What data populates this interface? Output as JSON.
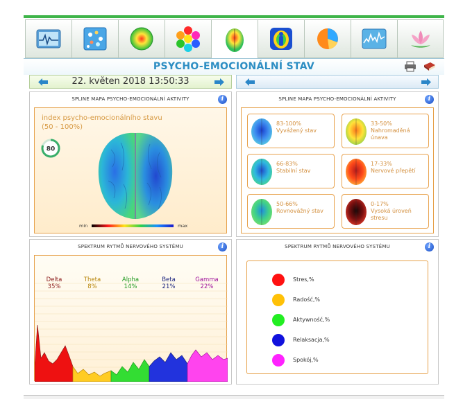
{
  "page": {
    "title": "PSYCHO-EMOCIONÁLNÍ STAV",
    "date": "22. květen 2018 13:50:33"
  },
  "tabs": [
    {
      "name": "cardio-icon",
      "active": false
    },
    {
      "name": "cells-icon",
      "active": false
    },
    {
      "name": "energy-ball-icon",
      "active": false
    },
    {
      "name": "hexagons-icon",
      "active": false
    },
    {
      "name": "brain-icon",
      "active": true
    },
    {
      "name": "aura-icon",
      "active": false
    },
    {
      "name": "pie-icon",
      "active": false
    },
    {
      "name": "waveform-icon",
      "active": false
    },
    {
      "name": "lotus-icon",
      "active": false
    }
  ],
  "toolbar": {
    "print_icon": "printer-icon",
    "book_icon": "book-icon"
  },
  "map_panel": {
    "title": "SPLINE MAPA PSYCHO-EMOCIONÁLNÍ AKTIVITY",
    "index_label": "index psycho-emocionálního stavu",
    "index_range": "(50 - 100%)",
    "index_value": "80",
    "index_fraction": 0.8,
    "scale_min": "min",
    "scale_max": "max"
  },
  "legend_panel": {
    "title": "SPLINE MAPA PSYCHO-EMOCIONÁLNÍ AKTIVITY",
    "items": [
      {
        "range": "83-100%",
        "line1": "Vyvážený stav",
        "line2": "",
        "palette": "blue"
      },
      {
        "range": "33-50%",
        "line1": "Nahromaděná",
        "line2": "únava",
        "palette": "yellow"
      },
      {
        "range": "66-83%",
        "line1": "Stabilní stav",
        "line2": "",
        "palette": "bluegreen"
      },
      {
        "range": "17-33%",
        "line1": "Nervové přepětí",
        "line2": "",
        "palette": "red"
      },
      {
        "range": "50-66%",
        "line1": "Rovnovážný stav",
        "line2": "",
        "palette": "green"
      },
      {
        "range": "0-17%",
        "line1": "Vysoká úroveň",
        "line2": "stresu",
        "palette": "dark"
      }
    ]
  },
  "spectrum_panel": {
    "title": "SPEKTRUM RYTMŮ NERVOVÉHO SYSTÉMU",
    "bands": [
      {
        "name": "Delta",
        "value": "35%",
        "color": "#8b1a1a",
        "fill": "#ee1111"
      },
      {
        "name": "Theta",
        "value": "8%",
        "color": "#b8860b",
        "fill": "#ffcc22"
      },
      {
        "name": "Alpha",
        "value": "14%",
        "color": "#1f9a1f",
        "fill": "#33dd33"
      },
      {
        "name": "Beta",
        "value": "21%",
        "color": "#1a237e",
        "fill": "#2233dd"
      },
      {
        "name": "Gamma",
        "value": "22%",
        "color": "#a0149b",
        "fill": "#ff44ee"
      }
    ]
  },
  "states_panel": {
    "title": "SPEKTRUM RYTMŮ NERVOVÉHO SYSTÉMU",
    "items": [
      {
        "label": "Stres,%",
        "color": "#ff1111"
      },
      {
        "label": "Radość,%",
        "color": "#ffc107"
      },
      {
        "label": "Aktywność,%",
        "color": "#22ee22"
      },
      {
        "label": "Relaksacja,%",
        "color": "#1111dd"
      },
      {
        "label": "Spokój,%",
        "color": "#ff22ff"
      }
    ]
  }
}
